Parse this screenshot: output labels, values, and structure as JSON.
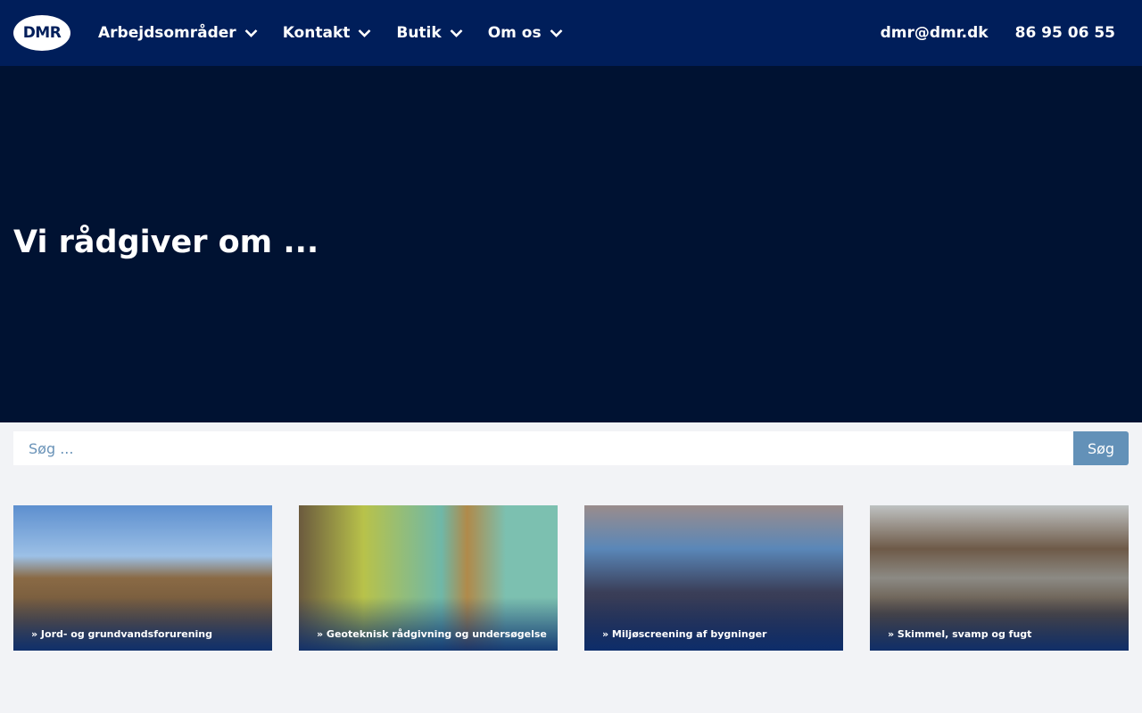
{
  "header": {
    "logo": "DMR",
    "menu": [
      {
        "label": "Arbejdsområder"
      },
      {
        "label": "Kontakt"
      },
      {
        "label": "Butik"
      },
      {
        "label": "Om os"
      }
    ],
    "email": "dmr@dmr.dk",
    "phone": "86 95 06 55"
  },
  "hero": {
    "title": "Vi rådgiver om ..."
  },
  "search": {
    "placeholder": "Søg ...",
    "button": "Søg"
  },
  "cards": [
    {
      "label": "» Jord- og grundvandsforurening"
    },
    {
      "label": "» Geoteknisk rådgivning og undersøgelse"
    },
    {
      "label": "» Miljøscreening af bygninger"
    },
    {
      "label": "» Skimmel, svamp og fugt"
    }
  ]
}
